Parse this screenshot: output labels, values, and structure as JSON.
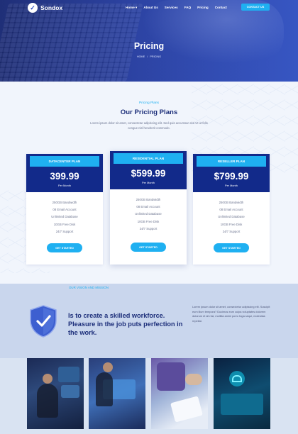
{
  "nav": {
    "logo": "Sondox",
    "items": [
      "Home ▾",
      "About Us",
      "Services",
      "FAQ",
      "Pricing",
      "Contact"
    ],
    "cta": "CONTACT US"
  },
  "hero": {
    "title": "Pricing",
    "breadcrumb": [
      "HOME",
      "PRICING"
    ]
  },
  "pricing": {
    "eyebrow": "Pricing Plans",
    "title": "Our Pricing Plans",
    "subtitle": "Lorem ipsum dolor sit amet, consectetur adipiscing elit. Sed quis accumsan nisi Ut ut felis congue nisl hendrerit commodo.",
    "plans": [
      {
        "name": "DATACENTER PLAN",
        "price": "399.99",
        "period": "Per Month",
        "features": [
          "250GB Bandwidth",
          "08 Email Account",
          "Unlimited Database",
          "10GB Free Disk",
          "24/7 Support"
        ],
        "button": "GET STARTED"
      },
      {
        "name": "RESIDENTIAL PLAN",
        "price": "$599.99",
        "period": "Per Month",
        "features": [
          "250GB Bandwidth",
          "08 Email Account",
          "Unlimited Database",
          "10GB Free Disk",
          "24/7 Support"
        ],
        "button": "GET STARTED"
      },
      {
        "name": "RESELLER PLAN",
        "price": "$799.99",
        "period": "Per Month",
        "features": [
          "250GB Bandwidth",
          "08 Email Account",
          "Unlimited Database",
          "10GB Free Disk",
          "24/7 Support"
        ],
        "button": "GET STARTED"
      }
    ]
  },
  "vision": {
    "eyebrow": "OUR VISION AND MISSION",
    "headline": "Is to create a skilled workforce. Pleasure in the job puts perfection in the work.",
    "paragraph": "Lorem ipsum dolor sit amet, consectetur adipiscing elit. Suscipit eum illum tempora? Ducimus eum culpa voluptates dolorem dolorum et sit nisi, mollitia animi porro fuga sequi, molestias repellat."
  },
  "colors": {
    "brand_navy": "#122a8a",
    "accent_cyan": "#1fb0f1",
    "title_navy": "#1d2f7a"
  }
}
